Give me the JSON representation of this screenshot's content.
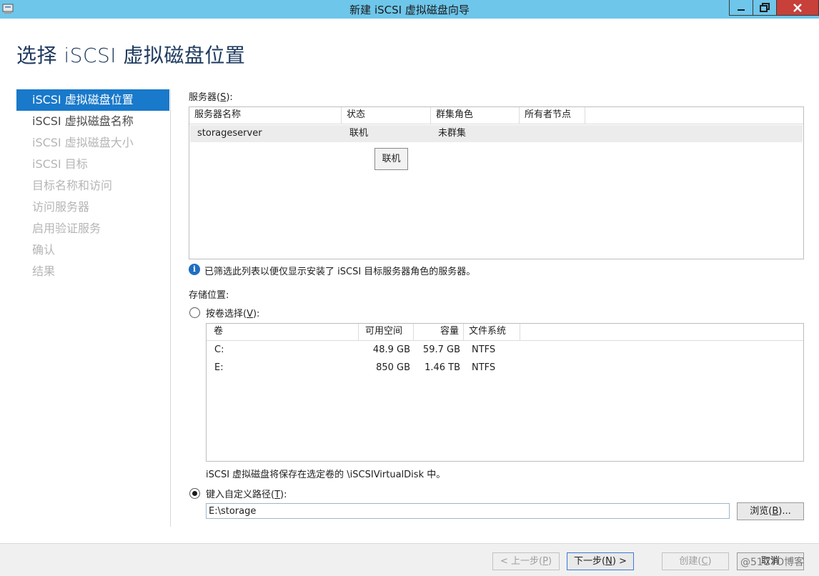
{
  "window": {
    "title": "新建 iSCSI 虚拟磁盘向导",
    "app_icon": "server-manager-icon",
    "title_color": "#6ec6ea"
  },
  "page": {
    "heading": "选择 iSCSI 虚拟磁盘位置"
  },
  "nav": {
    "items": [
      {
        "label": "iSCSI 虚拟磁盘位置",
        "state": "active"
      },
      {
        "label": "iSCSI 虚拟磁盘名称",
        "state": "enabled"
      },
      {
        "label": "iSCSI 虚拟磁盘大小",
        "state": "disabled"
      },
      {
        "label": "iSCSI 目标",
        "state": "disabled"
      },
      {
        "label": "目标名称和访问",
        "state": "disabled"
      },
      {
        "label": "访问服务器",
        "state": "disabled"
      },
      {
        "label": "启用验证服务",
        "state": "disabled"
      },
      {
        "label": "确认",
        "state": "disabled"
      },
      {
        "label": "结果",
        "state": "disabled"
      }
    ]
  },
  "servers": {
    "label": "服务器(",
    "accel": "S",
    "label_end": "):",
    "columns": [
      "服务器名称",
      "状态",
      "群集角色",
      "所有者节点"
    ],
    "rows": [
      {
        "name": "storageserver",
        "status": "联机",
        "cluster_role": "未群集",
        "owner_node": ""
      }
    ],
    "tooltip": "联机",
    "info_text": "已筛选此列表以便仅显示安装了 iSCSI 目标服务器角色的服务器。"
  },
  "storage": {
    "label": "存储位置:",
    "by_volume": {
      "label": "按卷选择(",
      "accel": "V",
      "label_end": "):",
      "selected": false,
      "columns": [
        "卷",
        "可用空间",
        "容量",
        "文件系统"
      ],
      "rows": [
        {
          "volume": "C:",
          "free": "48.9 GB",
          "capacity": "59.7 GB",
          "fs": "NTFS"
        },
        {
          "volume": "E:",
          "free": "850 GB",
          "capacity": "1.46 TB",
          "fs": "NTFS"
        }
      ],
      "note": "iSCSI 虚拟磁盘将保存在选定卷的 \\iSCSIVirtualDisk 中。"
    },
    "custom_path": {
      "label": "键入自定义路径(",
      "accel": "T",
      "label_end": "):",
      "selected": true,
      "value": "E:\\storage",
      "browse_label": "浏览(",
      "browse_accel": "B",
      "browse_end": ")..."
    }
  },
  "footer": {
    "prev": {
      "label": "< 上一步(",
      "accel": "P",
      "end": ")",
      "enabled": false
    },
    "next": {
      "label": "下一步(",
      "accel": "N",
      "end": ") >",
      "enabled": true
    },
    "create": {
      "label": "创建(",
      "accel": "C",
      "end": ")",
      "enabled": false
    },
    "cancel": {
      "label": "取消"
    }
  },
  "watermark": "@51CTO博客"
}
